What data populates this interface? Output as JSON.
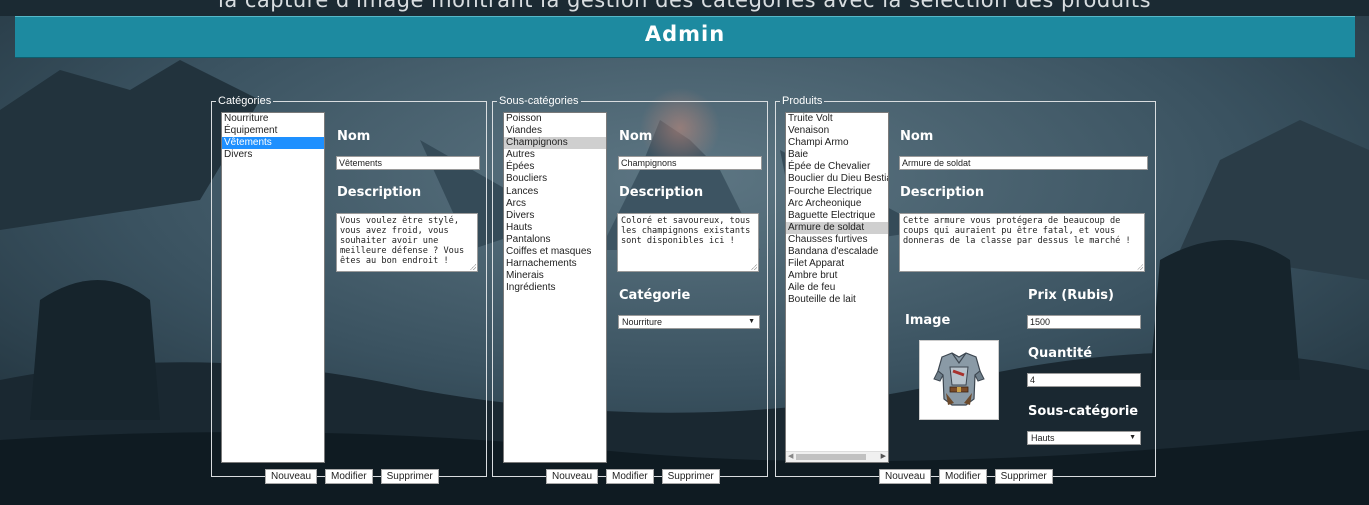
{
  "top_caption": "la capture d'image montrant la gestion des catégories avec la sélection des produits",
  "header": {
    "title": "Admin"
  },
  "categories": {
    "legend": "Catégories",
    "items": [
      "Nourriture",
      "Équipement",
      "Vêtements",
      "Divers"
    ],
    "selected_index": 2,
    "name_label": "Nom",
    "name_value": "Vêtements",
    "desc_label": "Description",
    "desc_value": "Vous voulez être stylé, vous avez froid, vous souhaiter avoir une meilleure défense ? Vous êtes au bon endroit !",
    "buttons": {
      "new": "Nouveau",
      "edit": "Modifier",
      "delete": "Supprimer"
    }
  },
  "subcategories": {
    "legend": "Sous-catégories",
    "items": [
      "Poisson",
      "Viandes",
      "Champignons",
      "Autres",
      "Épées",
      "Boucliers",
      "Lances",
      "Arcs",
      "Divers",
      "Hauts",
      "Pantalons",
      "Coiffes et masques",
      "Harnachements",
      "Minerais",
      "Ingrédients"
    ],
    "selected_index": 2,
    "name_label": "Nom",
    "name_value": "Champignons",
    "desc_label": "Description",
    "desc_value": "Coloré et savoureux, tous les champignons existants sont disponibles ici !",
    "category_label": "Catégorie",
    "category_value": "Nourriture",
    "buttons": {
      "new": "Nouveau",
      "edit": "Modifier",
      "delete": "Supprimer"
    }
  },
  "products": {
    "legend": "Produits",
    "items": [
      "Truite Volt",
      "Venaison",
      "Champi Armo",
      "Baie",
      "Épée de Chevalier",
      "Bouclier du Dieu Bestial",
      "Fourche Electrique",
      "Arc Archeonique",
      "Baguette Electrique",
      "Armure de soldat",
      "Chausses furtives",
      "Bandana d'escalade",
      "Filet Apparat",
      "Ambre brut",
      "Aile de feu",
      "Bouteille de lait"
    ],
    "selected_index": 9,
    "name_label": "Nom",
    "name_value": "Armure de soldat",
    "desc_label": "Description",
    "desc_value": "Cette armure vous protégera de beaucoup de coups qui auraient pu être fatal, et vous donneras de la classe par dessus le marché !",
    "image_label": "Image",
    "price_label": "Prix (Rubis)",
    "price_value": "1500",
    "quantity_label": "Quantité",
    "quantity_value": "4",
    "subcategory_label": "Sous-catégorie",
    "subcategory_value": "Hauts",
    "buttons": {
      "new": "Nouveau",
      "edit": "Modifier",
      "delete": "Supprimer"
    }
  },
  "colors": {
    "header_bg": "#1d8aa0",
    "selected_blue": "#1e90ff",
    "selected_grey": "#cfcfcf",
    "panel_border": "#d9dde0"
  }
}
